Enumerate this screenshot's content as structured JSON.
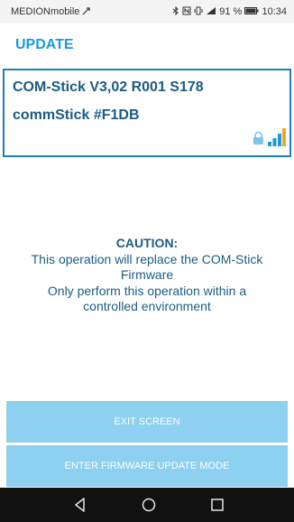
{
  "status_bar": {
    "carrier": "MEDIONmobile",
    "battery": "91 %",
    "time": "10:34"
  },
  "app_bar": {
    "title": "UPDATE"
  },
  "device": {
    "name": "COM-Stick V3,02 R001 S178",
    "id_label": "commStick #F1DB",
    "icons": [
      "lock-icon",
      "signal-bars-icon"
    ]
  },
  "caution": {
    "heading": "CAUTION:",
    "line1": "This operation will replace the COM-Stick",
    "line2": "Firmware",
    "line3": "Only perform this operation within a",
    "line4": "controlled environment"
  },
  "buttons": {
    "exit_label": "EXIT SCREEN",
    "firmware_label": "ENTER FIRMWARE UPDATE MODE"
  },
  "nav": {
    "icons": [
      "back-icon",
      "home-icon",
      "recent-apps-icon"
    ]
  },
  "colors": {
    "accent": "#1a9ad9",
    "device_text": "#1b5c82",
    "button_bg": "#8dd0f0",
    "nav_bg": "#111111"
  }
}
